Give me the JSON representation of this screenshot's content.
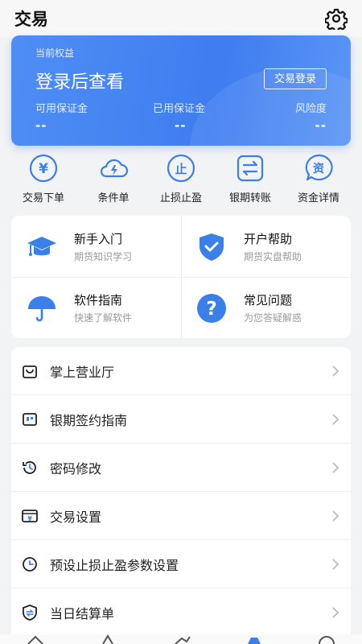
{
  "header": {
    "title": "交易",
    "settings_icon": "gear-icon"
  },
  "account": {
    "equity_label": "当前权益",
    "equity_value": "登录后查看",
    "login_button": "交易登录",
    "stats": [
      {
        "label": "可用保证金",
        "value": "--"
      },
      {
        "label": "已用保证金",
        "value": "--"
      },
      {
        "label": "风险度",
        "value": "--"
      }
    ]
  },
  "quick_actions": [
    {
      "label": "交易下单",
      "icon": "yen-icon",
      "glyph": "¥"
    },
    {
      "label": "条件单",
      "icon": "cloud-lightning-icon",
      "glyph": ""
    },
    {
      "label": "止损止盈",
      "icon": "stop-icon",
      "glyph": "止"
    },
    {
      "label": "银期转账",
      "icon": "transfer-icon",
      "glyph": ""
    },
    {
      "label": "资金详情",
      "icon": "funds-icon",
      "glyph": "资"
    }
  ],
  "guides": [
    {
      "title": "新手入门",
      "subtitle": "期货知识学习",
      "icon": "graduation-cap-icon"
    },
    {
      "title": "开户帮助",
      "subtitle": "期货实盘帮助",
      "icon": "shield-check-icon"
    },
    {
      "title": "软件指南",
      "subtitle": "快速了解软件",
      "icon": "umbrella-icon"
    },
    {
      "title": "常见问题",
      "subtitle": "为您答疑解惑",
      "icon": "question-icon",
      "glyph": "?"
    }
  ],
  "menu": [
    {
      "label": "掌上营业厅",
      "icon": "shopping-bag-icon"
    },
    {
      "label": "银期签约指南",
      "icon": "bank-card-icon"
    },
    {
      "label": "密码修改",
      "icon": "history-icon"
    },
    {
      "label": "交易设置",
      "icon": "yen-card-icon",
      "glyph": "¥"
    },
    {
      "label": "预设止损止盈参数设置",
      "icon": "clock-icon"
    },
    {
      "label": "当日结算单",
      "icon": "settlement-shield-icon"
    }
  ],
  "colors": {
    "accent": "#3f7df0",
    "icon_blue": "#3b7fe8",
    "background": "#f2f3f5"
  }
}
